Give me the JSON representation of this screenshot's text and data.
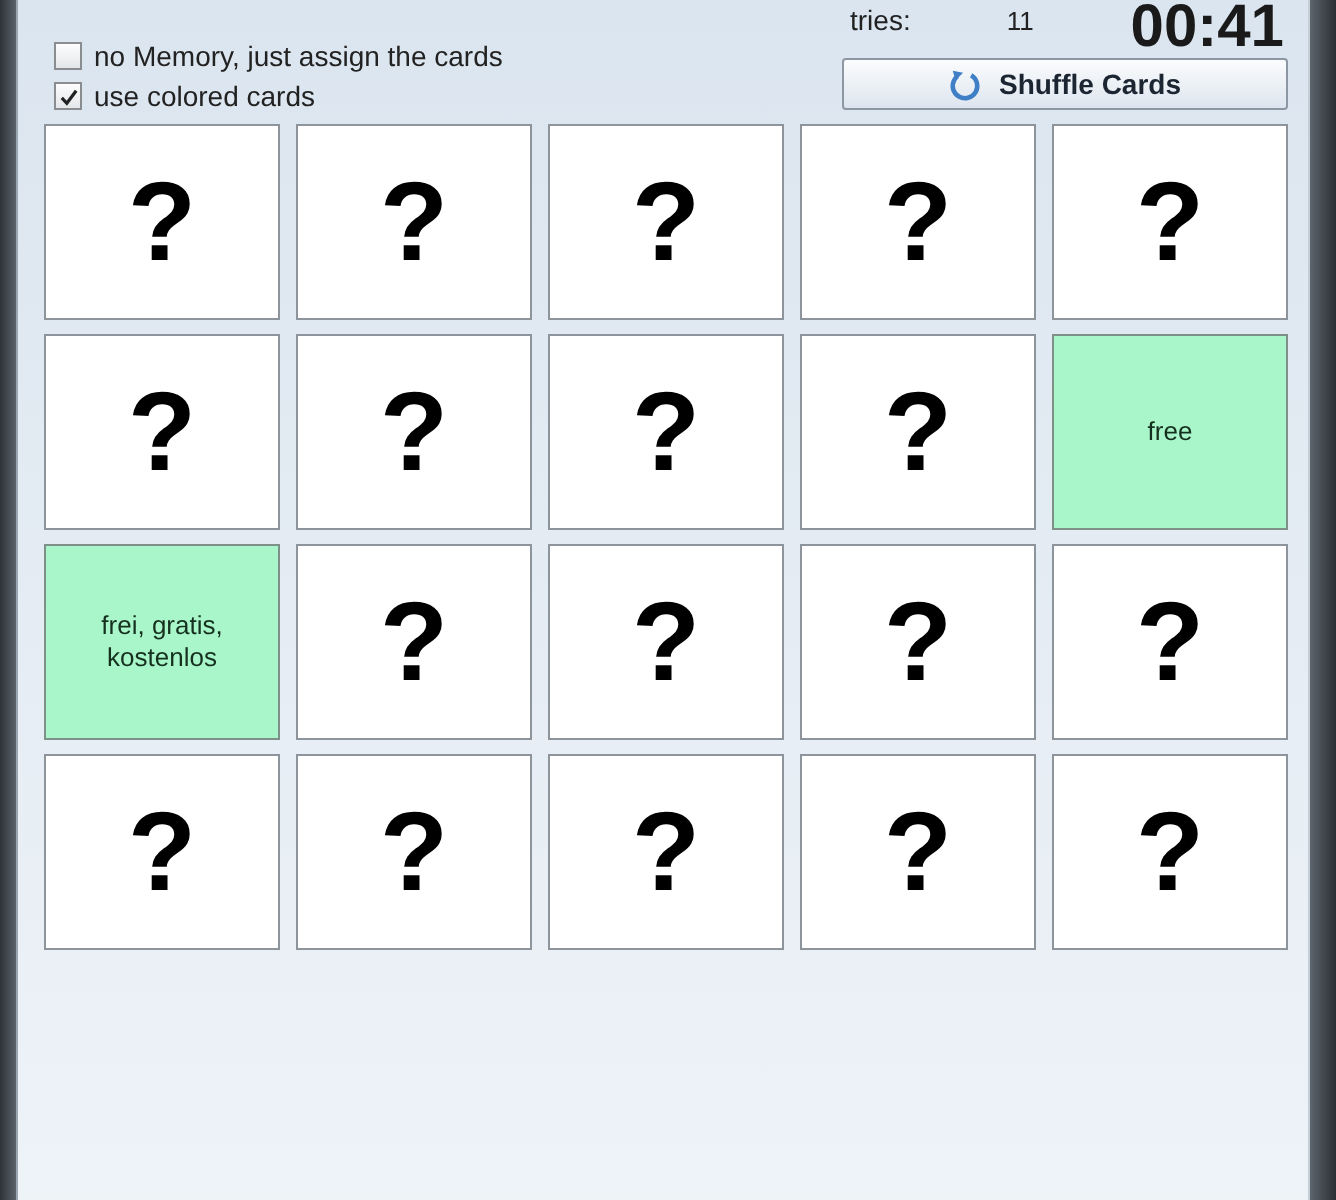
{
  "options": [
    {
      "label": "no Memory, just assign the cards",
      "checked": false
    },
    {
      "label": "use colored cards",
      "checked": true
    }
  ],
  "stats": {
    "tries_label": "tries:",
    "tries": "11",
    "timer": "00:41"
  },
  "shuffle_button": {
    "label": "Shuffle Cards"
  },
  "cards": [
    {
      "face_up": false,
      "text": "?"
    },
    {
      "face_up": false,
      "text": "?"
    },
    {
      "face_up": false,
      "text": "?"
    },
    {
      "face_up": false,
      "text": "?"
    },
    {
      "face_up": false,
      "text": "?"
    },
    {
      "face_up": false,
      "text": "?"
    },
    {
      "face_up": false,
      "text": "?"
    },
    {
      "face_up": false,
      "text": "?"
    },
    {
      "face_up": false,
      "text": "?"
    },
    {
      "face_up": true,
      "text": "free",
      "color": "#a8f6c9"
    },
    {
      "face_up": true,
      "text": "frei, gratis, kostenlos",
      "color": "#a8f6c9"
    },
    {
      "face_up": false,
      "text": "?"
    },
    {
      "face_up": false,
      "text": "?"
    },
    {
      "face_up": false,
      "text": "?"
    },
    {
      "face_up": false,
      "text": "?"
    },
    {
      "face_up": false,
      "text": "?"
    },
    {
      "face_up": false,
      "text": "?"
    },
    {
      "face_up": false,
      "text": "?"
    },
    {
      "face_up": false,
      "text": "?"
    },
    {
      "face_up": false,
      "text": "?"
    }
  ]
}
